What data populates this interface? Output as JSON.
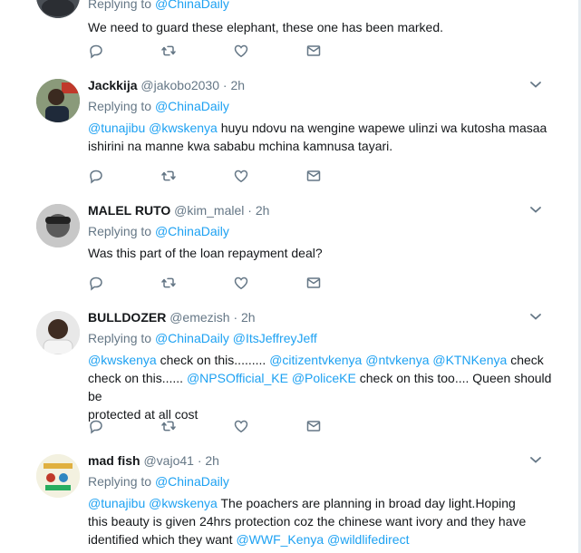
{
  "colors": {
    "accent": "#1da1f2",
    "muted": "#657786",
    "text": "#14171a",
    "divider": "#e6ecf0"
  },
  "icons": [
    "reply-icon",
    "retweet-icon",
    "like-icon",
    "message-icon",
    "chevron-down-icon"
  ],
  "tweets": [
    {
      "reply_label": "Replying to",
      "reply_to": [
        "@ChinaDaily"
      ],
      "text": "We need to guard these elephant, these one has been marked."
    },
    {
      "name": "Jackkija",
      "handle": "@jakobo2030",
      "dot": "·",
      "time": "2h",
      "reply_label": "Replying to",
      "reply_to": [
        "@ChinaDaily"
      ],
      "mentions": [
        "@tunajibu",
        "@kwskenya"
      ],
      "text_line1": "huyu ndovu na wengine wapewe ulinzi wa kutosha masaa",
      "text_line2": "ishirini na manne kwa sababu mchina kamnusa tayari."
    },
    {
      "name": "MALEL RUTO",
      "handle": "@kim_malel",
      "dot": "·",
      "time": "2h",
      "reply_label": "Replying to",
      "reply_to": [
        "@ChinaDaily"
      ],
      "text": "Was this part of the loan repayment deal?"
    },
    {
      "name": "BULLDOZER",
      "handle": "@emezish",
      "dot": "·",
      "time": "2h",
      "reply_label": "Replying to",
      "reply_to": [
        "@ChinaDaily",
        "@ItsJeffreyJeff"
      ],
      "seg1": "check on this.........",
      "seg2": "check",
      "seg3": "check on this......",
      "seg4": "check on this too....  Queen should be",
      "seg5": "protected at all cost",
      "m1": "@kwskenya",
      "m2": "@citizentvkenya",
      "m3": "@ntvkenya",
      "m4": "@KTNKenya",
      "m5": "@NPSOfficial_KE",
      "m6": "@PoliceKE"
    },
    {
      "name": "mad fish",
      "handle": "@vajo41",
      "dot": "·",
      "time": "2h",
      "reply_label": "Replying to",
      "reply_to": [
        "@ChinaDaily"
      ],
      "m1": "@tunajibu",
      "m2": "@kwskenya",
      "seg1": "The poachers are  planning in broad day light.Hoping",
      "seg2": "this beauty is   given 24hrs protection coz the chinese want ivory and they  have",
      "seg3": "identified  which  they want",
      "m3": "@WWF_Kenya",
      "m4": "@wildlifedirect"
    }
  ]
}
